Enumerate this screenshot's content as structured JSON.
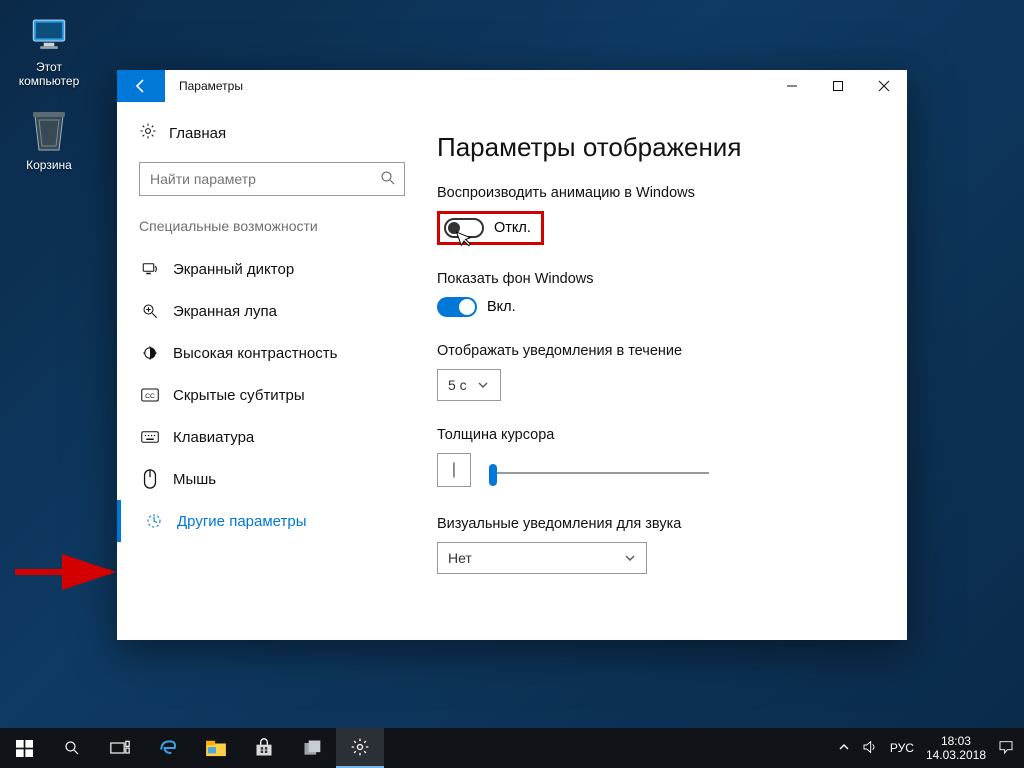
{
  "desktop": {
    "this_pc": "Этот компьютер",
    "recycle": "Корзина"
  },
  "window": {
    "title": "Параметры"
  },
  "sidebar": {
    "home": "Главная",
    "search_placeholder": "Найти параметр",
    "category": "Специальные возможности",
    "items": [
      {
        "label": "Экранный диктор"
      },
      {
        "label": "Экранная лупа"
      },
      {
        "label": "Высокая контрастность"
      },
      {
        "label": "Скрытые субтитры"
      },
      {
        "label": "Клавиатура"
      },
      {
        "label": "Мышь"
      },
      {
        "label": "Другие параметры"
      }
    ]
  },
  "content": {
    "heading": "Параметры отображения",
    "anim_label": "Воспроизводить анимацию в Windows",
    "anim_state": "Откл.",
    "bg_label": "Показать фон Windows",
    "bg_state": "Вкл.",
    "notif_label": "Отображать уведомления в течение",
    "notif_value": "5 с",
    "cursor_label": "Толщина курсора",
    "visual_label": "Визуальные уведомления для звука",
    "visual_value": "Нет"
  },
  "taskbar": {
    "lang": "РУС",
    "time": "18:03",
    "date": "14.03.2018"
  }
}
